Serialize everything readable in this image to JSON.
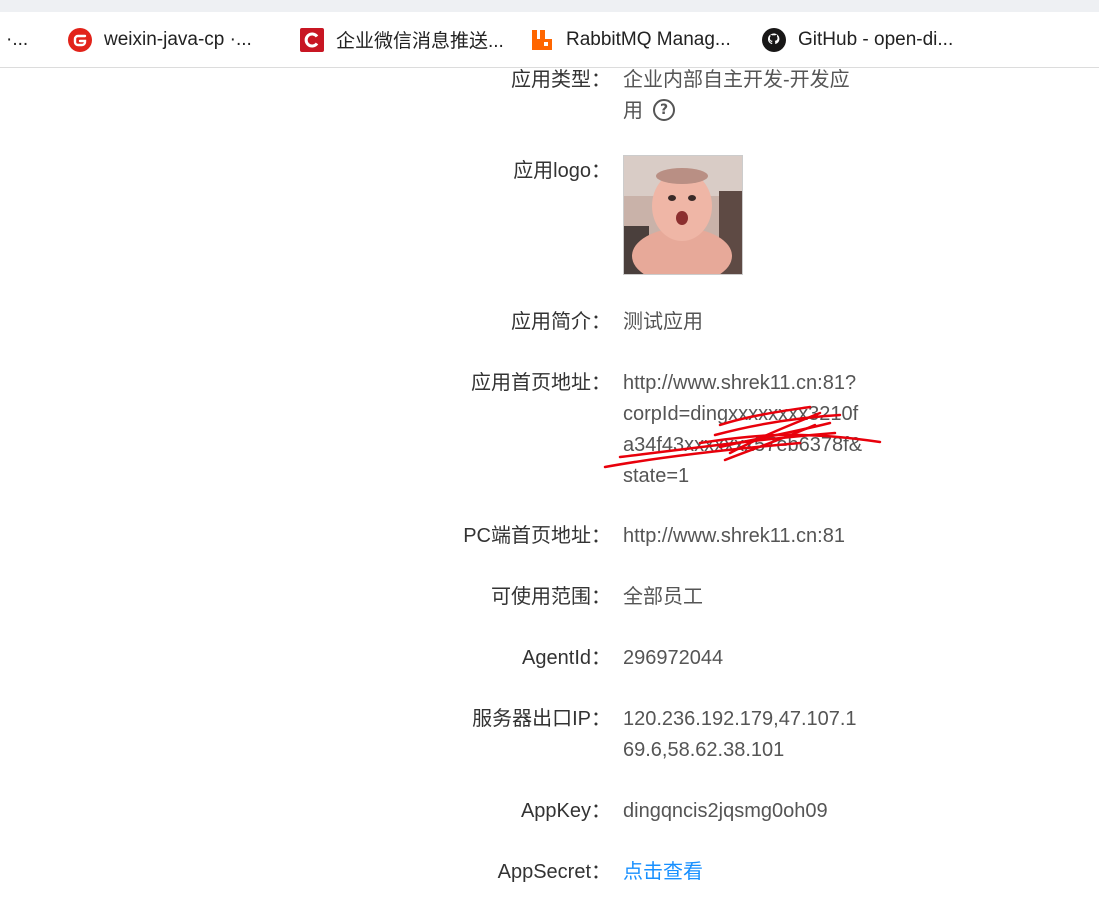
{
  "bookmarks": [
    {
      "label": "·..."
    },
    {
      "label": "weixin-java-cp ·...",
      "icon": "gitee-icon",
      "color": "#e2231a"
    },
    {
      "label": "企业微信消息推送...",
      "icon": "csdn-icon",
      "color": "#c81623"
    },
    {
      "label": "RabbitMQ Manag...",
      "icon": "rabbitmq-icon",
      "color": "#ff6600"
    },
    {
      "label": "GitHub - open-di...",
      "icon": "github-icon",
      "color": "#181717"
    }
  ],
  "app": {
    "type_label": "应用类型：",
    "type_value": "企业内部自主开发-开发应用",
    "logo_label": "应用logo：",
    "intro_label": "应用简介：",
    "intro_value": "测试应用",
    "home_url_label": "应用首页地址：",
    "home_url_value": "http://www.shrek11.cn:81?corpId=dingxxxxxxxx3210fa34f43xxxxxxx57eb6378f&state=1",
    "pc_url_label": "PC端首页地址：",
    "pc_url_value": "http://www.shrek11.cn:81",
    "scope_label": "可使用范围：",
    "scope_value": "全部员工",
    "agentid_label": "AgentId：",
    "agentid_value": "296972044",
    "ip_label": "服务器出口IP：",
    "ip_value": "120.236.192.179,47.107.169.6,58.62.38.101",
    "appkey_label": "AppKey：",
    "appkey_value": "dingqncis2jqsmg0oh09",
    "appsecret_label": "AppSecret：",
    "appsecret_link": "点击查看"
  },
  "colors": {
    "link": "#1890ff",
    "scribble": "#e8000b"
  }
}
